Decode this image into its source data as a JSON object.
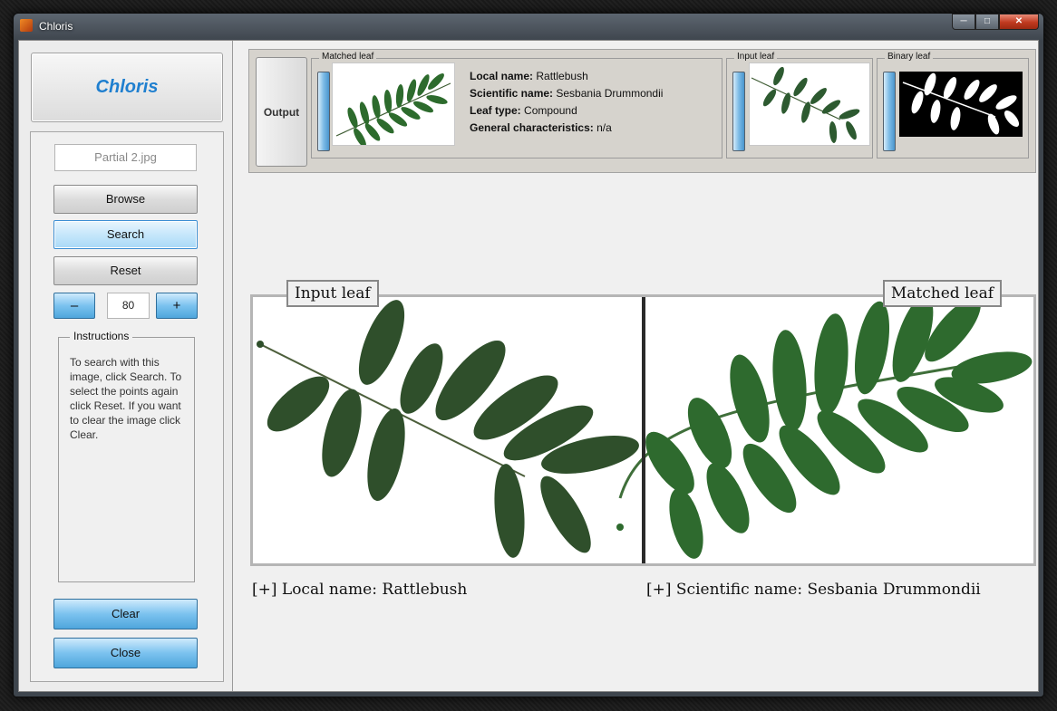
{
  "window": {
    "title": "Chloris"
  },
  "sidebar": {
    "logo": "Chloris",
    "file_name": "Partial 2.jpg",
    "browse_label": "Browse",
    "search_label": "Search",
    "reset_label": "Reset",
    "stepper": {
      "minus": "–",
      "value": "80",
      "plus": "+"
    },
    "instructions_title": "Instructions",
    "instructions_text": "To search with this image, click Search. To select the points again click Reset. If you want to clear the image click Clear.",
    "clear_label": "Clear",
    "close_label": "Close"
  },
  "output": {
    "button_label": "Output",
    "matched_group": "Matched leaf",
    "input_group": "Input leaf",
    "binary_group": "Binary leaf",
    "local_name_label": "Local name:",
    "local_name_value": "Rattlebush",
    "scientific_name_label": "Scientific name:",
    "scientific_name_value": "Sesbania Drummondii",
    "leaf_type_label": "Leaf type:",
    "leaf_type_value": "Compound",
    "general_label": "General characteristics:",
    "general_value": "n/a"
  },
  "comparison": {
    "input_label": "Input leaf",
    "matched_label": "Matched leaf",
    "local_caption": "[+] Local name: Rattlebush",
    "scientific_caption": "[+] Scientific name: Sesbania Drummondii"
  },
  "colors": {
    "leaf": "#2f5f33",
    "accent": "#1f7fcf"
  }
}
